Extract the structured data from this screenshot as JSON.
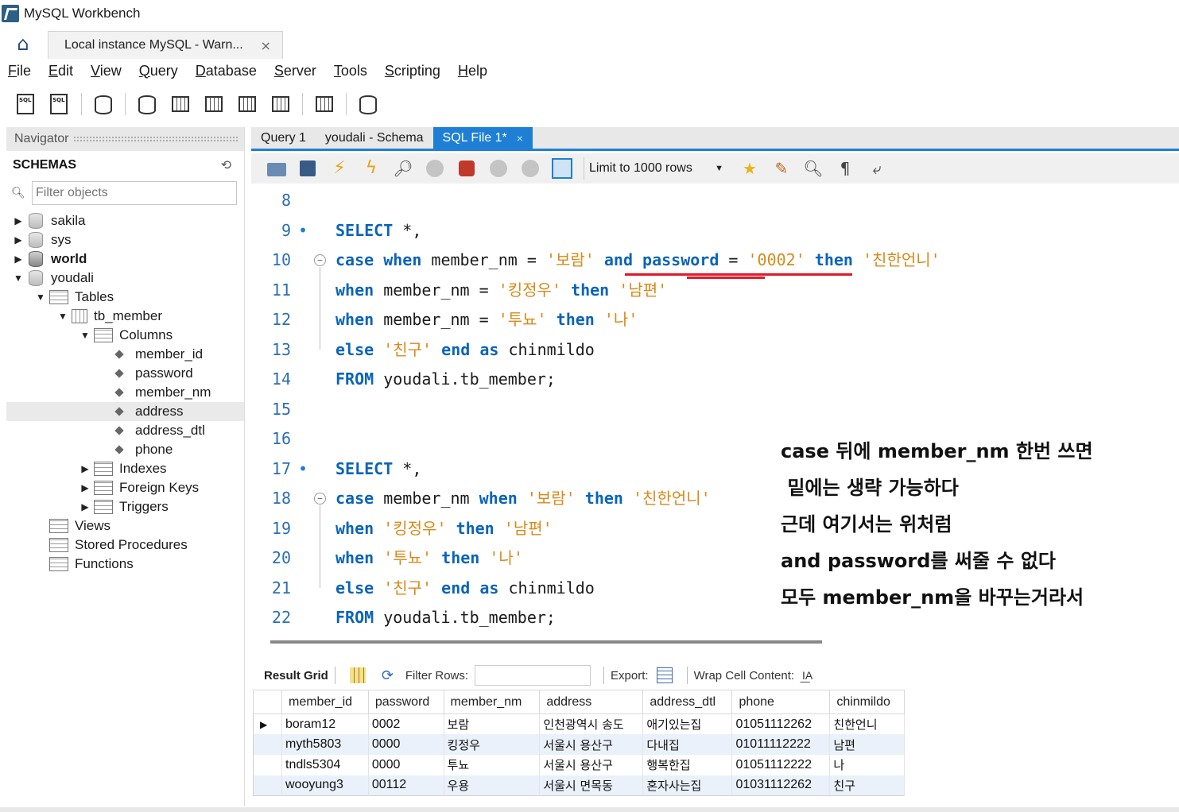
{
  "window": {
    "title": "MySQL Workbench"
  },
  "connection_tab": {
    "label": "Local instance MySQL - Warn...",
    "close": "×"
  },
  "menu": [
    "File",
    "Edit",
    "View",
    "Query",
    "Database",
    "Server",
    "Tools",
    "Scripting",
    "Help"
  ],
  "navigator": {
    "header": "Navigator",
    "schemas_label": "SCHEMAS",
    "filter_placeholder": "Filter objects",
    "tree": [
      {
        "label": "sakila",
        "level": 0,
        "arrow": "▶",
        "icon": "database",
        "bold": false
      },
      {
        "label": "sys",
        "level": 0,
        "arrow": "▶",
        "icon": "database",
        "bold": false
      },
      {
        "label": "world",
        "level": 0,
        "arrow": "▶",
        "icon": "database",
        "bold": true
      },
      {
        "label": "youdali",
        "level": 0,
        "arrow": "▼",
        "icon": "database",
        "bold": false
      },
      {
        "label": "Tables",
        "level": 1,
        "arrow": "▼",
        "icon": "folder",
        "bold": false
      },
      {
        "label": "tb_member",
        "level": 2,
        "arrow": "▼",
        "icon": "table",
        "bold": false
      },
      {
        "label": "Columns",
        "level": 3,
        "arrow": "▼",
        "icon": "folder",
        "bold": false
      },
      {
        "label": "member_id",
        "level": 4,
        "arrow": "",
        "icon": "column",
        "bold": false
      },
      {
        "label": "password",
        "level": 4,
        "arrow": "",
        "icon": "column",
        "bold": false
      },
      {
        "label": "member_nm",
        "level": 4,
        "arrow": "",
        "icon": "column",
        "bold": false
      },
      {
        "label": "address",
        "level": 4,
        "arrow": "",
        "icon": "column",
        "bold": false,
        "selected": true
      },
      {
        "label": "address_dtl",
        "level": 4,
        "arrow": "",
        "icon": "column",
        "bold": false
      },
      {
        "label": "phone",
        "level": 4,
        "arrow": "",
        "icon": "column",
        "bold": false
      },
      {
        "label": "Indexes",
        "level": 3,
        "arrow": "▶",
        "icon": "folder",
        "bold": false
      },
      {
        "label": "Foreign Keys",
        "level": 3,
        "arrow": "▶",
        "icon": "folder",
        "bold": false
      },
      {
        "label": "Triggers",
        "level": 3,
        "arrow": "▶",
        "icon": "folder",
        "bold": false
      },
      {
        "label": "Views",
        "level": 1,
        "arrow": "",
        "icon": "folder",
        "bold": false
      },
      {
        "label": "Stored Procedures",
        "level": 1,
        "arrow": "",
        "icon": "folder",
        "bold": false
      },
      {
        "label": "Functions",
        "level": 1,
        "arrow": "",
        "icon": "folder",
        "bold": false
      }
    ]
  },
  "editor_tabs": [
    {
      "label": "Query 1",
      "active": false
    },
    {
      "label": "youdali - Schema",
      "active": false
    },
    {
      "label": "SQL File 1*",
      "active": true,
      "close": "×"
    }
  ],
  "editor_toolbar": {
    "limit_label": "Limit to 1000 rows"
  },
  "code_lines": [
    {
      "num": "8",
      "marker": "",
      "fold": "",
      "tokens": []
    },
    {
      "num": "9",
      "marker": "•",
      "fold": "",
      "tokens": [
        [
          "SELECT",
          "kw"
        ],
        [
          " *,",
          ""
        ]
      ]
    },
    {
      "num": "10",
      "marker": "",
      "fold": "⊖",
      "tokens": [
        [
          "case",
          "kw"
        ],
        [
          " ",
          ""
        ],
        [
          "when",
          "kw"
        ],
        [
          " member_nm = ",
          ""
        ],
        [
          "'보람'",
          "str"
        ],
        [
          " ",
          ""
        ],
        [
          "and",
          "kw"
        ],
        [
          " ",
          ""
        ],
        [
          "password",
          "kw"
        ],
        [
          " = ",
          ""
        ],
        [
          "'0002'",
          "str"
        ],
        [
          " ",
          ""
        ],
        [
          "then",
          "kw"
        ],
        [
          " ",
          ""
        ],
        [
          "'친한언니'",
          "str"
        ]
      ]
    },
    {
      "num": "11",
      "marker": "",
      "fold": "",
      "tokens": [
        [
          "when",
          "kw"
        ],
        [
          " member_nm = ",
          ""
        ],
        [
          "'킹정우'",
          "str"
        ],
        [
          " ",
          ""
        ],
        [
          "then",
          "kw"
        ],
        [
          " ",
          ""
        ],
        [
          "'남편'",
          "str"
        ]
      ]
    },
    {
      "num": "12",
      "marker": "",
      "fold": "",
      "tokens": [
        [
          "when",
          "kw"
        ],
        [
          " member_nm = ",
          ""
        ],
        [
          "'투뇨'",
          "str"
        ],
        [
          " ",
          ""
        ],
        [
          "then",
          "kw"
        ],
        [
          " ",
          ""
        ],
        [
          "'나'",
          "str"
        ]
      ]
    },
    {
      "num": "13",
      "marker": "",
      "fold": "",
      "tokens": [
        [
          "else",
          "kw"
        ],
        [
          " ",
          ""
        ],
        [
          "'친구'",
          "str"
        ],
        [
          " ",
          ""
        ],
        [
          "end",
          "kw"
        ],
        [
          " ",
          ""
        ],
        [
          "as",
          "kw"
        ],
        [
          " chinmildo",
          ""
        ]
      ]
    },
    {
      "num": "14",
      "marker": "",
      "fold": "",
      "tokens": [
        [
          "FROM",
          "kw"
        ],
        [
          " youdali.tb_member;",
          ""
        ]
      ]
    },
    {
      "num": "15",
      "marker": "",
      "fold": "",
      "tokens": []
    },
    {
      "num": "16",
      "marker": "",
      "fold": "",
      "tokens": []
    },
    {
      "num": "17",
      "marker": "•",
      "fold": "",
      "tokens": [
        [
          "SELECT",
          "kw"
        ],
        [
          " *,",
          ""
        ]
      ]
    },
    {
      "num": "18",
      "marker": "",
      "fold": "⊖",
      "tokens": [
        [
          "case",
          "kw"
        ],
        [
          " member_nm ",
          ""
        ],
        [
          "when",
          "kw"
        ],
        [
          " ",
          ""
        ],
        [
          "'보람'",
          "str"
        ],
        [
          " ",
          ""
        ],
        [
          "then",
          "kw"
        ],
        [
          " ",
          ""
        ],
        [
          "'친한언니'",
          "str"
        ]
      ]
    },
    {
      "num": "19",
      "marker": "",
      "fold": "",
      "tokens": [
        [
          "when",
          "kw"
        ],
        [
          " ",
          ""
        ],
        [
          "'킹정우'",
          "str"
        ],
        [
          " ",
          ""
        ],
        [
          "then",
          "kw"
        ],
        [
          " ",
          ""
        ],
        [
          "'남편'",
          "str"
        ]
      ]
    },
    {
      "num": "20",
      "marker": "",
      "fold": "",
      "tokens": [
        [
          "when",
          "kw"
        ],
        [
          " ",
          ""
        ],
        [
          "'투뇨'",
          "str"
        ],
        [
          " ",
          ""
        ],
        [
          "then",
          "kw"
        ],
        [
          " ",
          ""
        ],
        [
          "'나'",
          "str"
        ]
      ]
    },
    {
      "num": "21",
      "marker": "",
      "fold": "",
      "tokens": [
        [
          "else",
          "kw"
        ],
        [
          " ",
          ""
        ],
        [
          "'친구'",
          "str"
        ],
        [
          " ",
          ""
        ],
        [
          "end",
          "kw"
        ],
        [
          " ",
          ""
        ],
        [
          "as",
          "kw"
        ],
        [
          " chinmildo",
          ""
        ]
      ]
    },
    {
      "num": "22",
      "marker": "",
      "fold": "",
      "tokens": [
        [
          "FROM",
          "kw"
        ],
        [
          " youdali.tb_member;",
          ""
        ]
      ]
    }
  ],
  "annotation_lines": [
    "case 뒤에 member_nm 한번 쓰면",
    " 밑에는 생략 가능하다",
    "근데 여기서는 위처럼",
    "and password를 써줄 수 없다",
    "모두 member_nm을 바꾸는거라서"
  ],
  "result_toolbar": {
    "result_grid": "Result Grid",
    "filter_rows": "Filter Rows:",
    "export": "Export:",
    "wrap": "Wrap Cell Content:"
  },
  "result_grid": {
    "columns": [
      "member_id",
      "password",
      "member_nm",
      "address",
      "address_dtl",
      "phone",
      "chinmildo"
    ],
    "rows": [
      [
        "boram12",
        "0002",
        "보람",
        "인천광역시 송도",
        "애기있는집",
        "01051112262",
        "친한언니"
      ],
      [
        "myth5803",
        "0000",
        "킹정우",
        "서울시 용산구",
        "다내집",
        "01011112222",
        "남편"
      ],
      [
        "tndls5304",
        "0000",
        "투뇨",
        "서울시 용산구",
        "행복한집",
        "01051112222",
        "나"
      ],
      [
        "wooyung3",
        "00112",
        "우용",
        "서울시 면목동",
        "혼자사는집",
        "01031112262",
        "친구"
      ]
    ],
    "current_row_marker": "▶"
  },
  "colors": {
    "accent": "#1e7fd4",
    "keyword": "#0a64b8",
    "string": "#d88a1a",
    "underline": "#e0182a",
    "alt_row": "#eaf1fb"
  }
}
